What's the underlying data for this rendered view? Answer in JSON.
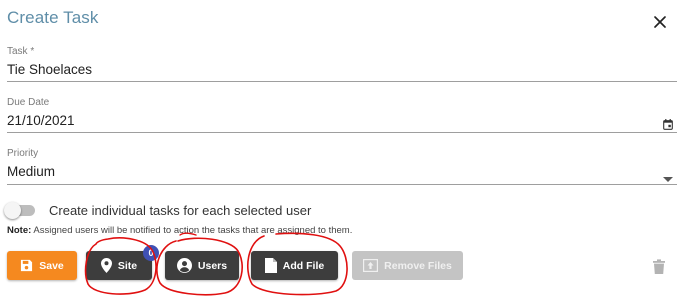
{
  "dialog": {
    "title": "Create Task"
  },
  "fields": {
    "task": {
      "label": "Task *",
      "value": "Tie Shoelaces"
    },
    "due_date": {
      "label": "Due Date",
      "value": "21/10/2021"
    },
    "priority": {
      "label": "Priority",
      "value": "Medium"
    }
  },
  "toggle": {
    "label": "Create individual tasks for each selected user",
    "checked": false
  },
  "note": {
    "prefix": "Note:",
    "text": " Assigned users will be notified to action the tasks that are assigned to them."
  },
  "buttons": {
    "save": "Save",
    "site": "Site",
    "site_badge": "0",
    "users": "Users",
    "add_file": "Add File",
    "remove_files": "Remove Files"
  },
  "colors": {
    "title": "#5f8ea8",
    "save": "#f5891f",
    "dark_button": "#3d3d3d",
    "disabled_button": "#c4c4c4",
    "badge": "#3f51b5",
    "annotation": "#e01010"
  },
  "icons": [
    "close-icon",
    "calendar-icon",
    "dropdown-arrow-icon",
    "save-icon",
    "location-pin-icon",
    "account-circle-icon",
    "file-icon",
    "remove-files-icon",
    "trash-icon"
  ]
}
